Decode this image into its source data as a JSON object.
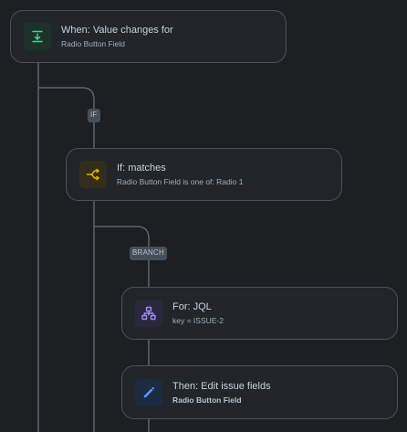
{
  "nodes": {
    "trigger": {
      "title": "When: Value changes for",
      "subtitle": "Radio Button Field",
      "icon": "field-changed-icon",
      "icon_color": "#4bce97",
      "icon_bg": "#1c3329"
    },
    "condition": {
      "title": "If: matches",
      "subtitle": "Radio Button Field is one of: Radio 1",
      "icon": "condition-branch-icon",
      "icon_color": "#e2b203",
      "icon_bg": "#332e1b"
    },
    "branch": {
      "title": "For: JQL",
      "subtitle": "key = ISSUE-2",
      "icon": "hierarchy-icon",
      "icon_color": "#9f8fef",
      "icon_bg": "#2b273f"
    },
    "action": {
      "title": "Then: Edit issue fields",
      "subtitle": "Radio Button Field",
      "icon": "edit-pencil-icon",
      "icon_color": "#579dff",
      "icon_bg": "#1c2b41"
    }
  },
  "labels": {
    "if": "IF",
    "branch": "BRANCH"
  },
  "colors": {
    "background": "#1d1f22",
    "card": "#22262a",
    "card_border": "#4b5157",
    "connector": "#5c656e",
    "pill_bg": "#454f59"
  }
}
